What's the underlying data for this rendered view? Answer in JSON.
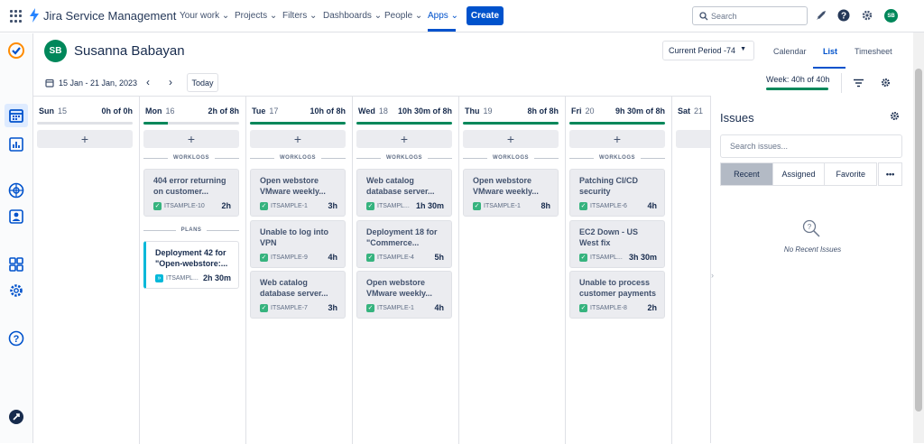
{
  "app": {
    "name": "Jira Service Management"
  },
  "nav": {
    "items": [
      {
        "label": "Your work",
        "chev": "⌄"
      },
      {
        "label": "Projects",
        "chev": "⌄"
      },
      {
        "label": "Filters",
        "chev": "⌄"
      },
      {
        "label": "Dashboards",
        "chev": "⌄"
      },
      {
        "label": "People",
        "chev": "⌄"
      },
      {
        "label": "Apps",
        "chev": "⌄"
      }
    ],
    "active": "Apps",
    "create_label": "Create",
    "search_placeholder": "Search",
    "avatar_initials": "SB"
  },
  "header": {
    "avatar_initials": "SB",
    "user_name": "Susanna Babayan",
    "period_label": "Current Period -74",
    "views": [
      "Calendar",
      "List",
      "Timesheet"
    ],
    "active_view": "List"
  },
  "toolbar": {
    "date_range": "15 Jan - 21 Jan, 2023",
    "today_label": "Today",
    "week_total": "Week: 40h of 40h",
    "week_progress": 1.0
  },
  "labels": {
    "worklogs": "WORKLOGS",
    "plans": "PLANS"
  },
  "days": [
    {
      "name": "Sun",
      "num": "15",
      "hours": "0h of 0h",
      "progress": 0,
      "worklogs": [],
      "plans": []
    },
    {
      "name": "Mon",
      "num": "16",
      "hours": "2h of 8h",
      "progress": 0.25,
      "worklogs": [
        {
          "title": "404 error returning on customer...",
          "key": "ITSAMPLE-10",
          "dur": "2h"
        }
      ],
      "plans": [
        {
          "title": "Deployment 42 for \"Open-webstore:...",
          "key": "ITSAMPL...",
          "dur": "2h 30m"
        }
      ]
    },
    {
      "name": "Tue",
      "num": "17",
      "hours": "10h of 8h",
      "progress": 1,
      "worklogs": [
        {
          "title": "Open webstore VMware weekly...",
          "key": "ITSAMPLE-1",
          "dur": "3h"
        },
        {
          "title": "Unable to log into VPN",
          "key": "ITSAMPLE-9",
          "dur": "4h"
        },
        {
          "title": "Web catalog database server...",
          "key": "ITSAMPLE-7",
          "dur": "3h"
        }
      ],
      "plans": []
    },
    {
      "name": "Wed",
      "num": "18",
      "hours": "10h 30m of 8h",
      "progress": 1,
      "worklogs": [
        {
          "title": "Web catalog database server...",
          "key": "ITSAMPL...",
          "dur": "1h 30m"
        },
        {
          "title": "Deployment 18 for \"Commerce...",
          "key": "ITSAMPLE-4",
          "dur": "5h"
        },
        {
          "title": "Open webstore VMware weekly...",
          "key": "ITSAMPLE-1",
          "dur": "4h"
        }
      ],
      "plans": []
    },
    {
      "name": "Thu",
      "num": "19",
      "hours": "8h of 8h",
      "progress": 1,
      "worklogs": [
        {
          "title": "Open webstore VMware weekly...",
          "key": "ITSAMPLE-1",
          "dur": "8h"
        }
      ],
      "plans": []
    },
    {
      "name": "Fri",
      "num": "20",
      "hours": "9h 30m of 8h",
      "progress": 1,
      "worklogs": [
        {
          "title": "Patching CI/CD security vulnerability",
          "key": "ITSAMPLE-6",
          "dur": "4h"
        },
        {
          "title": "EC2 Down - US West fix",
          "key": "ITSAMPL...",
          "dur": "3h 30m"
        },
        {
          "title": "Unable to process customer payments",
          "key": "ITSAMPLE-8",
          "dur": "2h"
        }
      ],
      "plans": []
    },
    {
      "name": "Sat",
      "num": "21",
      "hours": "",
      "progress": 0,
      "worklogs": [],
      "plans": []
    }
  ],
  "issues": {
    "title": "Issues",
    "search_placeholder": "Search issues...",
    "tabs": [
      "Recent",
      "Assigned",
      "Favorite"
    ],
    "more": "•••",
    "active_tab": "Recent",
    "empty_text": "No Recent Issues"
  },
  "colors": {
    "primary": "#0052cc",
    "success": "#00875a",
    "plan_accent": "#00b8d9"
  }
}
